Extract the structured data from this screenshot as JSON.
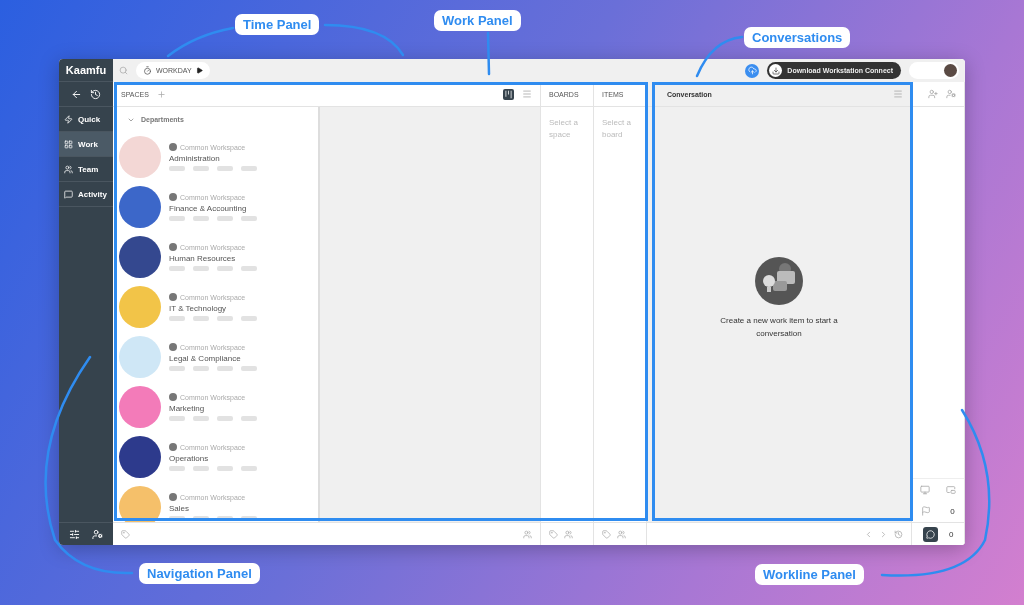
{
  "annotations": [
    {
      "label": "Time Panel"
    },
    {
      "label": "Work Panel"
    },
    {
      "label": "Conversations"
    },
    {
      "label": "Navigation Panel"
    },
    {
      "label": "Workline Panel"
    }
  ],
  "app": {
    "logo": "Kaamfu",
    "timer": {
      "label": "WORKDAY"
    },
    "download_button": "Download Workstation Connect",
    "nav": [
      {
        "label": "Quick",
        "selected": false
      },
      {
        "label": "Work",
        "selected": true
      },
      {
        "label": "Team",
        "selected": false
      },
      {
        "label": "Activity",
        "selected": false
      }
    ],
    "spaces": {
      "title": "SPACES",
      "group": "Departments",
      "items": [
        {
          "workspace": "Common Workspace",
          "name": "Administration"
        },
        {
          "workspace": "Common Workspace",
          "name": "Finance & Accounting"
        },
        {
          "workspace": "Common Workspace",
          "name": "Human Resources"
        },
        {
          "workspace": "Common Workspace",
          "name": "IT & Technology"
        },
        {
          "workspace": "Common Workspace",
          "name": "Legal & Compliance"
        },
        {
          "workspace": "Common Workspace",
          "name": "Marketing"
        },
        {
          "workspace": "Common Workspace",
          "name": "Operations"
        },
        {
          "workspace": "Common Workspace",
          "name": "Sales"
        }
      ]
    },
    "boards": {
      "title": "BOARDS",
      "placeholder": "Select a space"
    },
    "items": {
      "title": "ITEMS",
      "placeholder": "Select a board"
    },
    "conversation": {
      "title": "Conversation",
      "empty_message": "Create a new work item to start a conversation"
    },
    "workline": {
      "flag_count": "0",
      "chat_count": "0"
    }
  }
}
